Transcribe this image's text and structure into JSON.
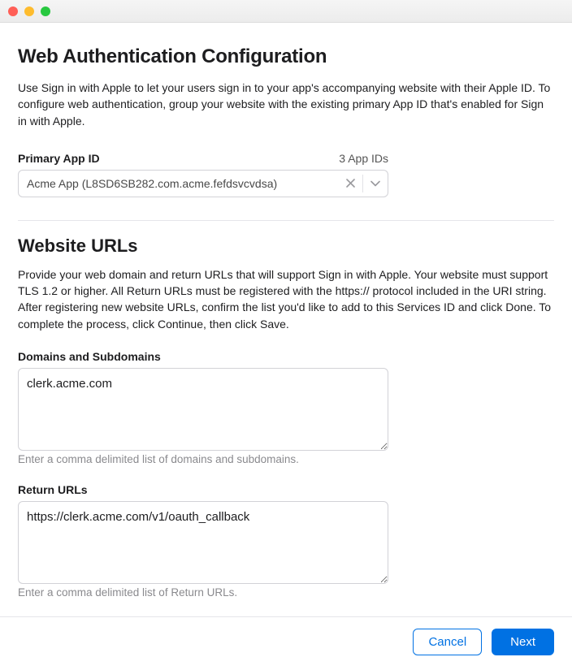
{
  "header": {
    "title": "Web Authentication Configuration",
    "intro": "Use Sign in with Apple to let your users sign in to your app's accompanying website with their Apple ID. To configure web authentication, group your website with the existing primary App ID that's enabled for Sign in with Apple."
  },
  "primary_app": {
    "label": "Primary App ID",
    "count_label": "3 App IDs",
    "selected": "Acme App (L8SD6SB282.com.acme.fefdsvcvdsa)"
  },
  "urls_section": {
    "title": "Website URLs",
    "desc": "Provide your web domain and return URLs that will support Sign in with Apple. Your website must support TLS 1.2 or higher. All Return URLs must be registered with the https:// protocol included in the URI string. After registering new website URLs, confirm the list you'd like to add to this Services ID and click Done. To complete the process, click Continue, then click Save."
  },
  "domains": {
    "label": "Domains and Subdomains",
    "value": "clerk.acme.com",
    "hint": "Enter a comma delimited list of domains and subdomains."
  },
  "return_urls": {
    "label": "Return URLs",
    "value": "https://clerk.acme.com/v1/oauth_callback",
    "hint": "Enter a comma delimited list of Return URLs."
  },
  "footer": {
    "cancel": "Cancel",
    "next": "Next"
  }
}
